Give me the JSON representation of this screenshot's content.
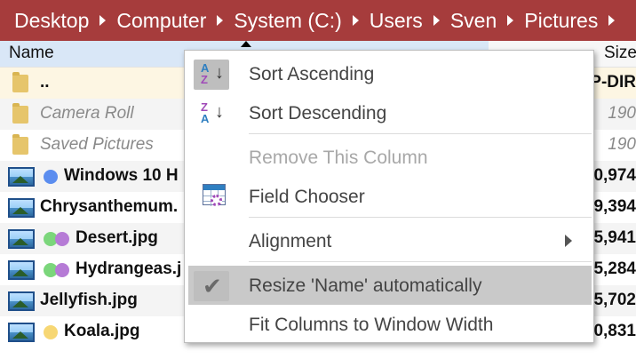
{
  "breadcrumb": {
    "items": [
      "Desktop",
      "Computer",
      "System (C:)",
      "Users",
      "Sven",
      "Pictures"
    ]
  },
  "columns": {
    "name": "Name",
    "size": "Size"
  },
  "rows": [
    {
      "name": "..",
      "size": "P-DIR",
      "type": "parent",
      "tags": []
    },
    {
      "name": "Camera Roll",
      "size": "190",
      "type": "folder",
      "tags": []
    },
    {
      "name": "Saved Pictures",
      "size": "190",
      "type": "folder",
      "tags": []
    },
    {
      "name": "Windows 10 H",
      "size": "0,974",
      "type": "image",
      "tags": [
        "#5b8def"
      ]
    },
    {
      "name": "Chrysanthemum.",
      "size": "9,394",
      "type": "image",
      "tags": []
    },
    {
      "name": "Desert.jpg",
      "size": "5,941",
      "type": "image",
      "tags": [
        "#7bd67b",
        "#b67bd6"
      ]
    },
    {
      "name": "Hydrangeas.j",
      "size": "5,284",
      "type": "image",
      "tags": [
        "#7bd67b",
        "#b67bd6"
      ]
    },
    {
      "name": "Jellyfish.jpg",
      "size": "5,702",
      "type": "image",
      "tags": []
    },
    {
      "name": "Koala.jpg",
      "size": "0,831",
      "type": "image",
      "tags": [
        "#f7d774"
      ]
    }
  ],
  "context_menu": {
    "sort_ascending": "Sort Ascending",
    "sort_descending": "Sort Descending",
    "remove_column": "Remove This Column",
    "field_chooser": "Field Chooser",
    "alignment": "Alignment",
    "resize_name": "Resize 'Name' automatically",
    "fit_columns": "Fit Columns to Window Width"
  },
  "colors": {
    "breadcrumb_bg": "#a63c3c",
    "header_highlight": "#d9e7f7",
    "menu_hot": "#c9c9c9"
  }
}
